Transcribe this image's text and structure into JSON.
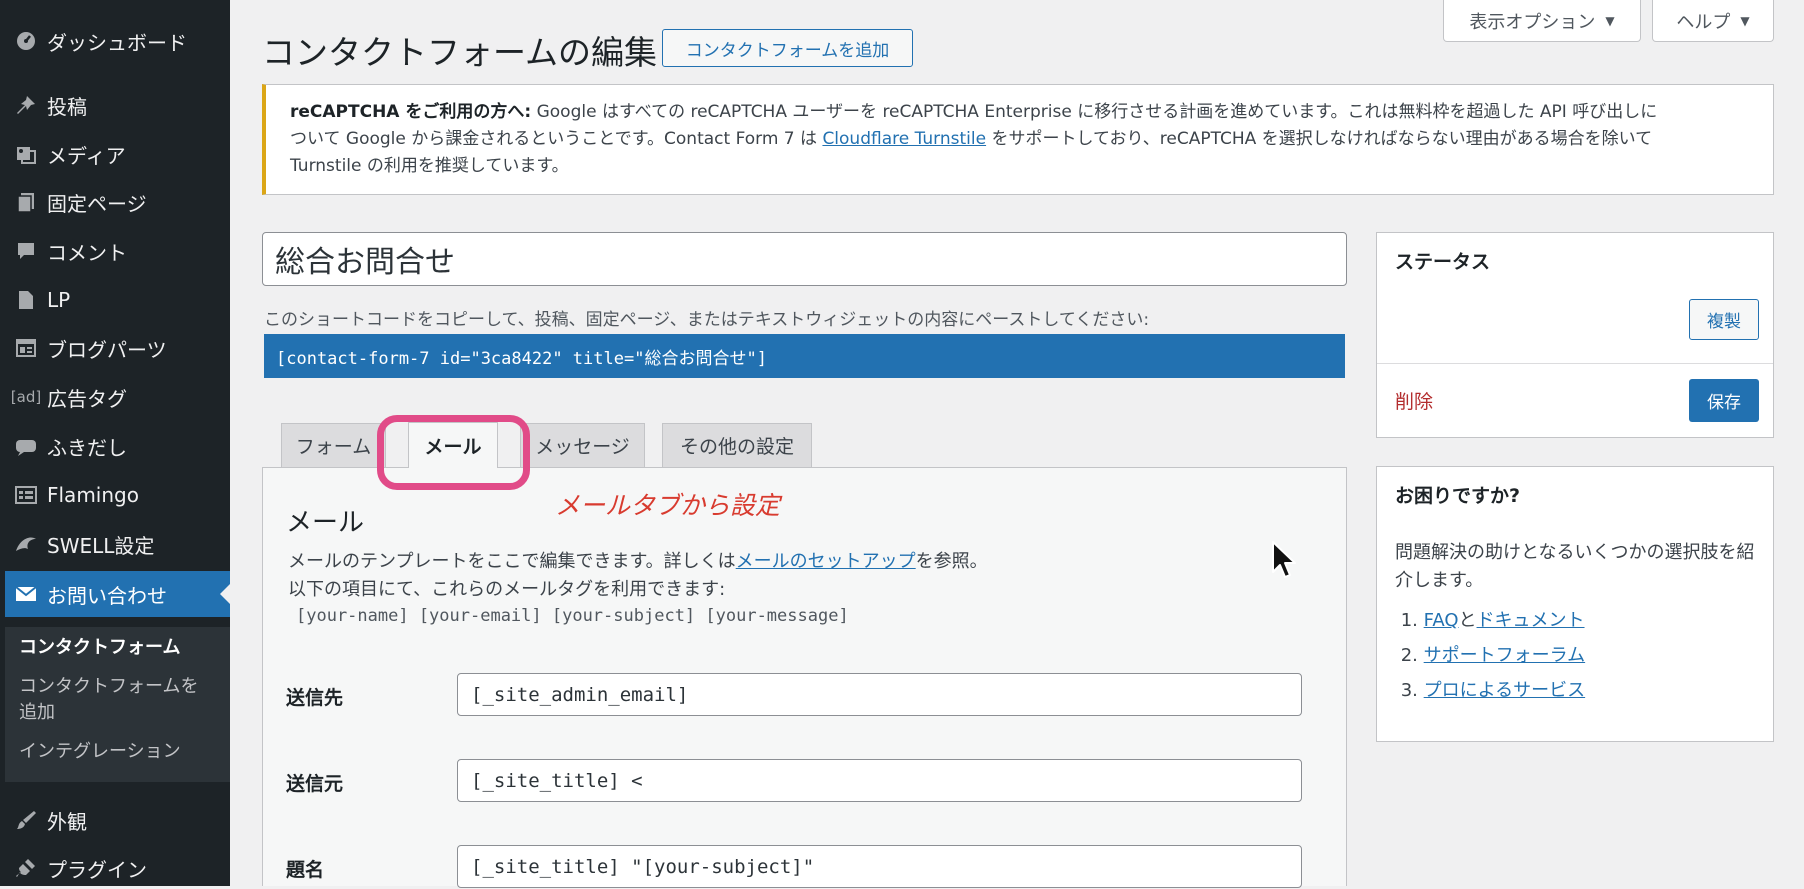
{
  "sidebar": {
    "items": [
      {
        "label": "ダッシュボード",
        "icon": "dashboard-icon"
      },
      {
        "label": "投稿",
        "icon": "pin-icon"
      },
      {
        "label": "メディア",
        "icon": "media-icon"
      },
      {
        "label": "固定ページ",
        "icon": "page-icon"
      },
      {
        "label": "コメント",
        "icon": "comment-icon"
      },
      {
        "label": "LP",
        "icon": "document-icon"
      },
      {
        "label": "ブログパーツ",
        "icon": "layout-icon"
      },
      {
        "label": "広告タグ",
        "icon": "ad-icon",
        "icon_text": "[ad]"
      },
      {
        "label": "ふきだし",
        "icon": "speech-bubble-icon"
      },
      {
        "label": "Flamingo",
        "icon": "list-icon"
      },
      {
        "label": "SWELL設定",
        "icon": "swell-icon"
      },
      {
        "label": "お問い合わせ",
        "icon": "mail-icon"
      },
      {
        "label": "外観",
        "icon": "brush-icon"
      },
      {
        "label": "プラグイン",
        "icon": "plugin-icon"
      }
    ],
    "submenu": [
      "コンタクトフォーム",
      "コンタクトフォームを",
      "追加",
      "インテグレーション"
    ]
  },
  "header": {
    "title": "コンタクトフォームの編集",
    "add_button": "コンタクトフォームを追加",
    "screen_options": "表示オプション",
    "help": "ヘルプ",
    "dropdown_glyph": "▼"
  },
  "notice": {
    "bold": "reCAPTCHA をご利用の方へ:",
    "text1": " Google はすべての reCAPTCHA ユーザーを reCAPTCHA Enterprise に移行させる計画を進めています。これは無料枠を超過した API 呼び出しに",
    "text2": "ついて Google から課金されるということです。Contact Form 7 は ",
    "link": "Cloudflare Turnstile",
    "text3": " をサポートしており、reCAPTCHA を選択しなければならない理由がある場合を除いて",
    "text4": "Turnstile の利用を推奨しています。"
  },
  "form": {
    "title_value": "総合お問合せ",
    "shortcode_desc": "このショートコードをコピーして、投稿、固定ページ、またはテキストウィジェットの内容にペーストしてください:",
    "shortcode": "[contact-form-7 id=\"3ca8422\" title=\"総合お問合せ\"]"
  },
  "tabs": [
    "フォーム",
    "メール",
    "メッセージ",
    "その他の設定"
  ],
  "annotation": "メールタブから設定",
  "mail_panel": {
    "heading": "メール",
    "desc1": "メールのテンプレートをここで編集できます。詳しくは",
    "desc_link": "メールのセットアップ",
    "desc2": "を参照。",
    "desc3": "以下の項目にて、これらのメールタグを利用できます:",
    "tags": "[your-name] [your-email] [your-subject] [your-message]",
    "fields": [
      {
        "label": "送信先",
        "value": "[_site_admin_email]"
      },
      {
        "label": "送信元",
        "value": "[_site_title] <"
      },
      {
        "label": "題名",
        "value": "[_site_title] \"[your-subject]\""
      }
    ]
  },
  "status_box": {
    "title": "ステータス",
    "duplicate": "複製",
    "delete": "削除",
    "save": "保存"
  },
  "help_box": {
    "title": "お困りですか?",
    "text": "問題解決の助けとなるいくつかの選択肢を紹介します。",
    "items": [
      {
        "num": "1.",
        "link1": "FAQ",
        "sep": "と",
        "link2": "ドキュメント"
      },
      {
        "num": "2.",
        "link1": "サポートフォーラム"
      },
      {
        "num": "3.",
        "link1": "プロによるサービス"
      }
    ]
  },
  "colors": {
    "sidebar_bg": "#1d2327",
    "accent": "#2271b1",
    "highlight": "#e14b88",
    "annotation": "#d83b2f",
    "notice_border": "#dba617",
    "delete": "#b32d2e"
  }
}
